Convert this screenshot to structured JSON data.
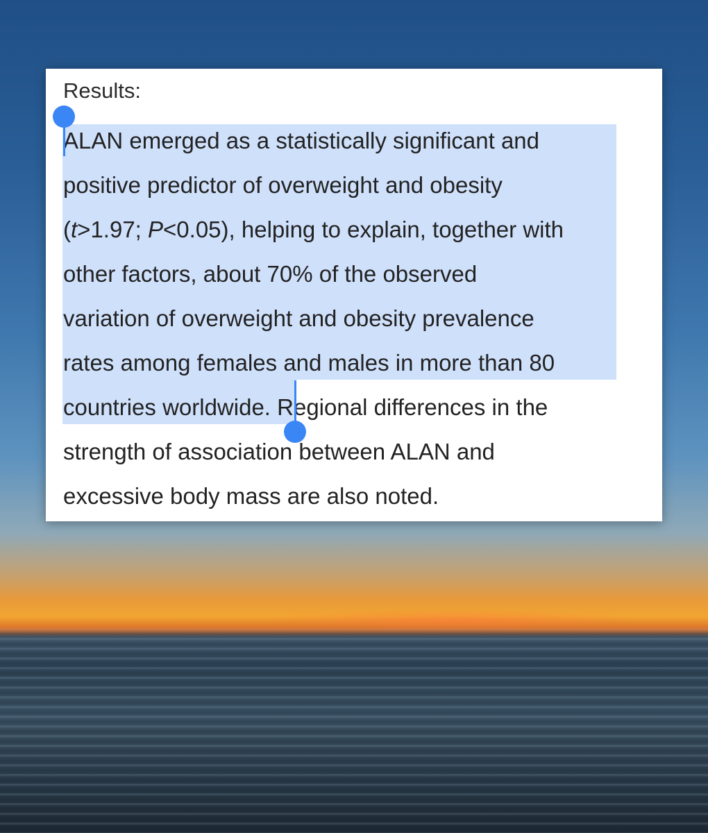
{
  "document": {
    "heading": "Results:",
    "lines": [
      "ALAN emerged as a statistically significant and",
      "positive predictor of overweight and obesity",
      "(t>1.97; P<0.05), helping to explain, together with",
      "other factors, about 70% of the observed",
      "variation of overweight and obesity prevalence",
      "rates among females and males in more than 80",
      "countries worldwide. Regional differences in the",
      "strength of association between ALAN and",
      "excessive body mass are also noted."
    ],
    "line3_parts": {
      "open": "(",
      "t": "t",
      "mid": ">1.97; ",
      "p": "P",
      "rest": "<0.05), helping to explain, together with"
    }
  },
  "selection": {
    "highlight_color": "#cfe0fb",
    "handle_color": "#3b86f5"
  }
}
